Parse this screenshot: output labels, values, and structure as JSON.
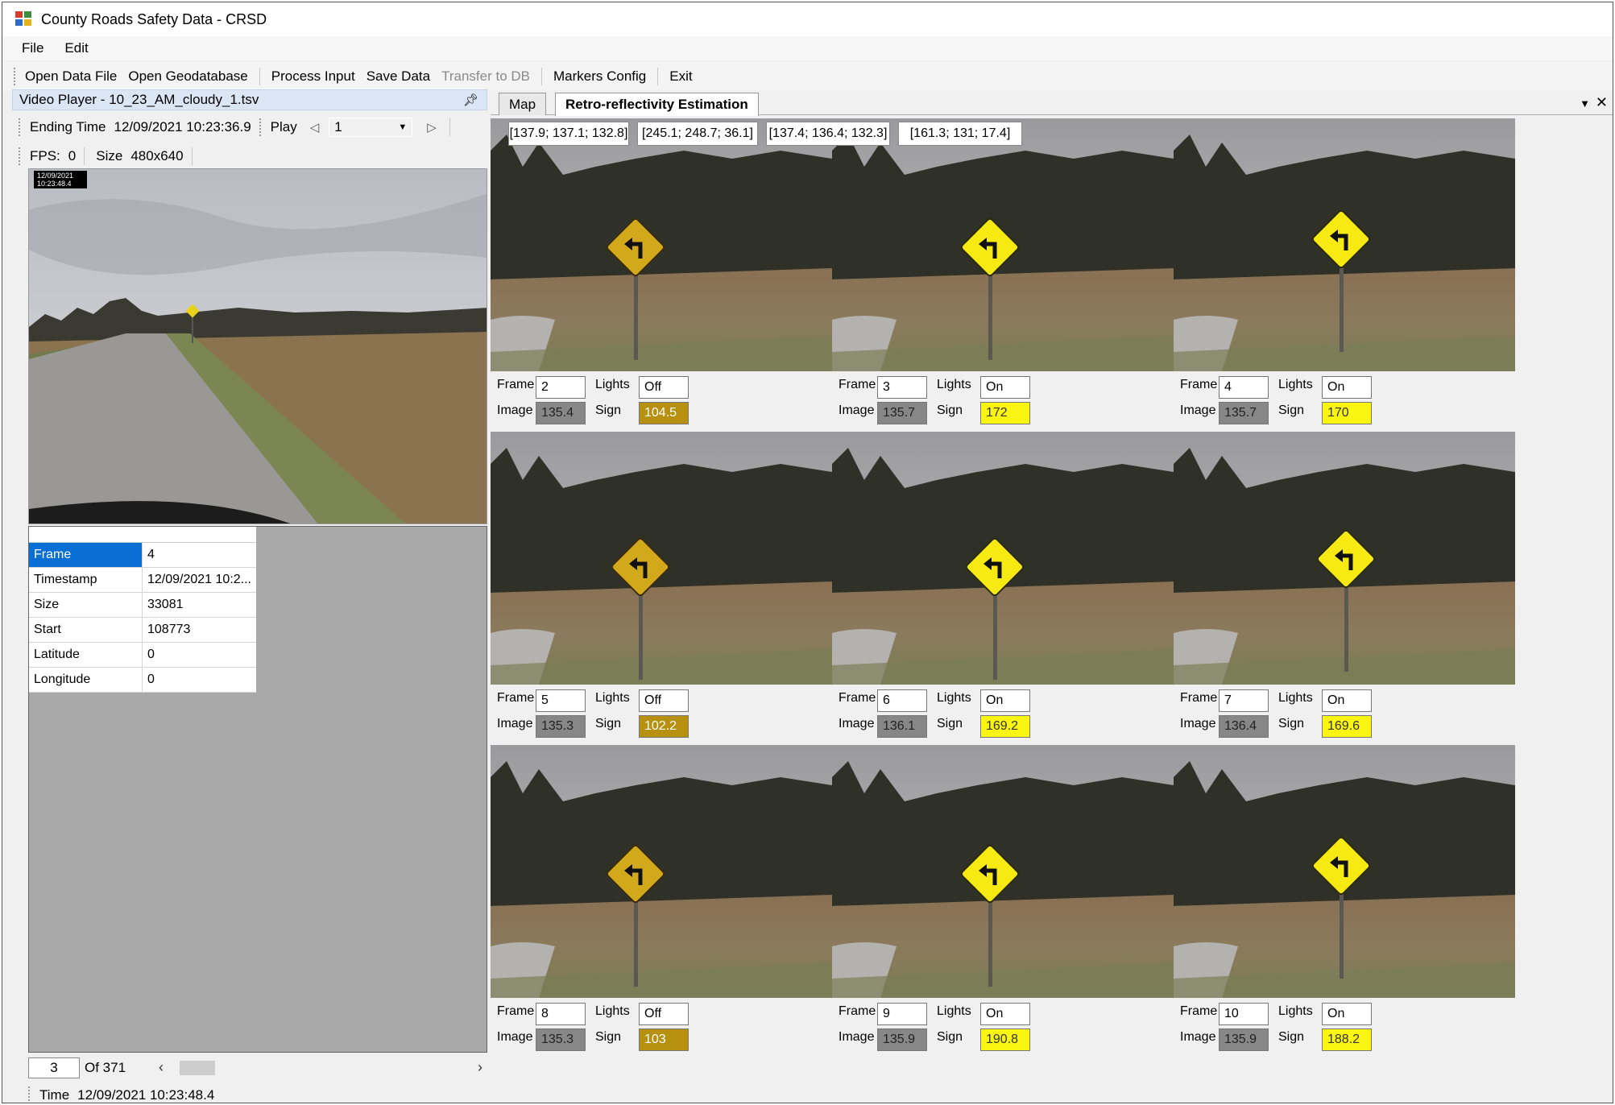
{
  "window": {
    "title": "County Roads Safety Data - CRSD"
  },
  "menu": [
    "File",
    "Edit"
  ],
  "toolbar": {
    "open_data_file": "Open Data File",
    "open_geodatabase": "Open Geodatabase",
    "process_input": "Process Input",
    "save_data": "Save Data",
    "transfer_to_db": "Transfer to DB",
    "markers_config": "Markers Config",
    "exit": "Exit"
  },
  "video_player": {
    "header": "Video Player - 10_23_AM_cloudy_1.tsv",
    "ending_time_label": "Ending Time",
    "ending_time": "12/09/2021 10:23:36.9",
    "play_label": "Play",
    "speed_value": "1",
    "fps_label": "FPS:",
    "fps_value": "0",
    "size_label": "Size",
    "size_value": "480x640",
    "stamp_line1": "12/09/2021",
    "stamp_line2": "10:23:48.4"
  },
  "properties": [
    {
      "key": "Frame",
      "value": "4"
    },
    {
      "key": "Timestamp",
      "value": "12/09/2021 10:2..."
    },
    {
      "key": "Size",
      "value": "33081"
    },
    {
      "key": "Start",
      "value": "108773"
    },
    {
      "key": "Latitude",
      "value": "0"
    },
    {
      "key": "Longitude",
      "value": "0"
    }
  ],
  "pager": {
    "current": "3",
    "of_label": "Of 371"
  },
  "status": {
    "time_label": "Time",
    "time_value": "12/09/2021 10:23:48.4"
  },
  "tabs": {
    "map": "Map",
    "retro": "Retro-reflectivity Estimation"
  },
  "rgb_boxes": [
    "[137.9; 137.1; 132.8]",
    "[245.1; 248.7; 36.1]",
    "[137.4; 136.4; 132.3]",
    "[161.3; 131; 17.4]"
  ],
  "labels": {
    "frame": "Frame",
    "lights": "Lights",
    "image": "Image",
    "sign": "Sign"
  },
  "frames": [
    {
      "frame": "2",
      "lights": "Off",
      "image": "135.4",
      "sign": "104.5",
      "sign_color": "#b8900f"
    },
    {
      "frame": "3",
      "lights": "On",
      "image": "135.7",
      "sign": "172",
      "sign_color": "#fbf512"
    },
    {
      "frame": "4",
      "lights": "On",
      "image": "135.7",
      "sign": "170",
      "sign_color": "#fbf512"
    },
    {
      "frame": "5",
      "lights": "Off",
      "image": "135.3",
      "sign": "102.2",
      "sign_color": "#b8900f"
    },
    {
      "frame": "6",
      "lights": "On",
      "image": "136.1",
      "sign": "169.2",
      "sign_color": "#fbf512"
    },
    {
      "frame": "7",
      "lights": "On",
      "image": "136.4",
      "sign": "169.6",
      "sign_color": "#fbf512"
    },
    {
      "frame": "8",
      "lights": "Off",
      "image": "135.3",
      "sign": "103",
      "sign_color": "#b8900f"
    },
    {
      "frame": "9",
      "lights": "On",
      "image": "135.9",
      "sign": "190.8",
      "sign_color": "#fbf512"
    },
    {
      "frame": "10",
      "lights": "On",
      "image": "135.9",
      "sign": "188.2",
      "sign_color": "#fbf512"
    }
  ]
}
